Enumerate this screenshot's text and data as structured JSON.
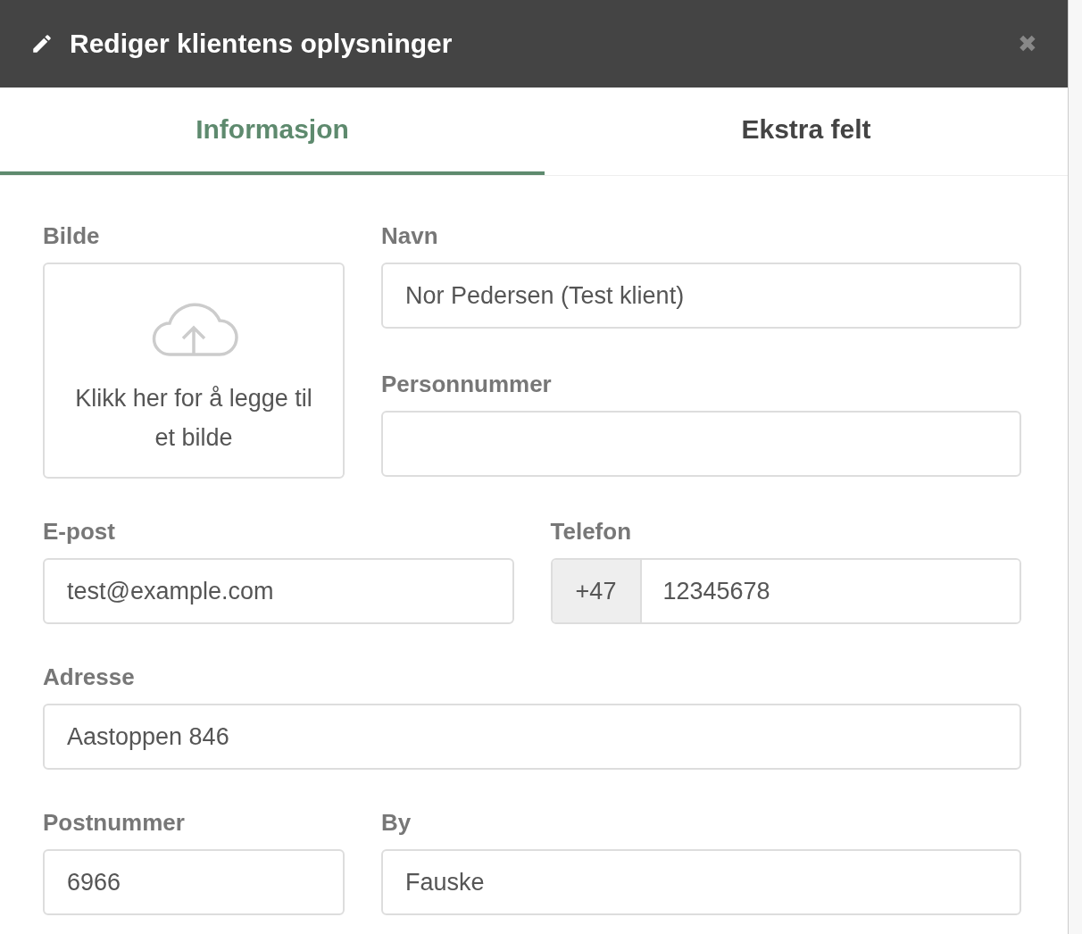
{
  "dialog": {
    "title": "Rediger klientens oplysninger",
    "close": "✖"
  },
  "tabs": [
    {
      "label": "Informasjon",
      "selected": true
    },
    {
      "label": "Ekstra felt",
      "selected": false
    }
  ],
  "image_upload": {
    "label": "Bilde",
    "hint": "Klikk her for å legge til et bilde"
  },
  "fields": {
    "name": {
      "label": "Navn",
      "value": "Nor Pedersen (Test klient)"
    },
    "personal_number": {
      "label": "Personnummer"
    },
    "email": {
      "label": "E-post",
      "value": "test@example.com"
    },
    "phone": {
      "label": "Telefon",
      "prefix": "+47",
      "value": "12345678"
    },
    "address": {
      "label": "Adresse",
      "value": "Aastoppen 846"
    },
    "postal_code": {
      "label": "Postnummer",
      "value": "6966"
    },
    "city": {
      "label": "By",
      "value": "Fauske"
    }
  }
}
